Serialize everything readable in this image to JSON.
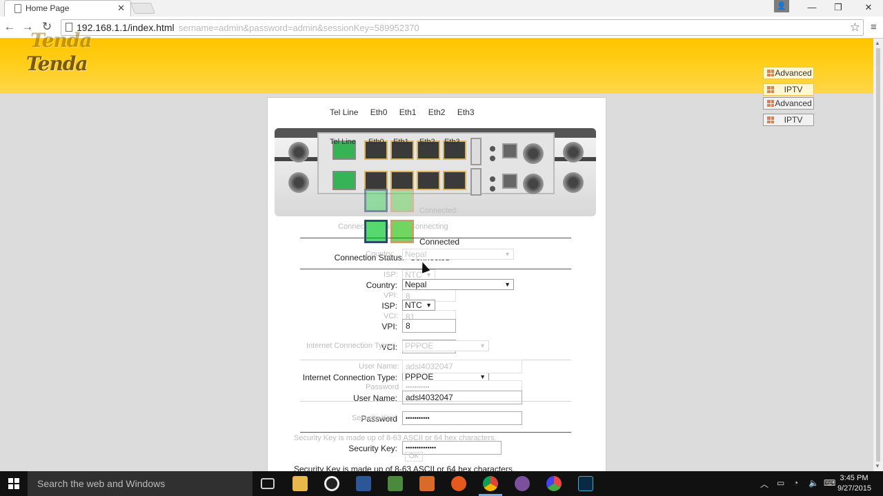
{
  "browser": {
    "tab_title": "Home Page",
    "close_tab": "✕",
    "url": "192.168.1.1/index.html",
    "url_ghost": "sername=admin&password=admin&sessionKey=589952370",
    "win_minimize": "—",
    "win_restore": "❐",
    "win_close": "✕"
  },
  "header": {
    "logo": "Tenda",
    "logo_ghost": "Tenda"
  },
  "side_buttons": {
    "ghost_advanced": "Advanced",
    "ghost_iptv": "IPTV",
    "advanced": "Advanced",
    "iptv": "IPTV"
  },
  "ports": {
    "labels": [
      "Tel Line",
      "Eth0",
      "Eth1",
      "Eth2",
      "Eth3"
    ],
    "ghost_labels": [
      "Tel Line",
      "Eth0",
      "Eth1",
      "Eth2",
      "Eth3"
    ]
  },
  "status": {
    "connected_ghost": "Connected",
    "connection_status_label_ghost": "Connection Status:",
    "connection_status_value_ghost": "Connecting",
    "connected": "Connected",
    "connection_status_label": "Connection Status:",
    "connection_status_value": "Connected"
  },
  "form": {
    "country_label_ghost": "Country:",
    "country_value_ghost": "Nepal",
    "isp_label_ghost": "ISP:",
    "isp_value_ghost": "NTC",
    "vpi_label_ghost": "VPI:",
    "vpi_value_ghost": "8",
    "vci_label_ghost": "VCI:",
    "vci_value_ghost": "81",
    "country_label": "Country:",
    "country_value": "Nepal",
    "isp_label": "ISP:",
    "isp_value": "NTC",
    "vpi_label": "VPI:",
    "vpi_value": "8",
    "vci_label": "VCI:",
    "vci_value": "81",
    "conn_type_label_ghost": "Internet Connection Type:",
    "conn_type_value_ghost": "PPPOE",
    "conn_type_label": "Internet Connection Type:",
    "conn_type_value": "PPPOE",
    "username_label_ghost": "User Name:",
    "username_value_ghost": "adsl4032047",
    "password_label_ghost": "Password",
    "password_value_ghost": "•••••••••••",
    "username_label": "User Name:",
    "username_value": "adsl4032047",
    "password_label": "Password",
    "password_value": "•••••••••••",
    "security_label_ghost": "Security Key:",
    "security_note_ghost": "Security Key is made up of 8-63 ASCII or 64 hex characters.",
    "security_label": "Security Key:",
    "security_value": "••••••••••••••",
    "ok_ghost": "OK",
    "security_note": "Security Key is made up of 8-63 ASCII or 64 hex characters."
  },
  "taskbar": {
    "search_placeholder": "Search the web and Windows",
    "time": "3:45 PM",
    "date": "9/27/2015"
  },
  "colors": {
    "header_yellow": "#ffc400",
    "panel_bg": "#ffffff",
    "page_bg": "#dcdcdc",
    "port_green": "#55d86d"
  }
}
